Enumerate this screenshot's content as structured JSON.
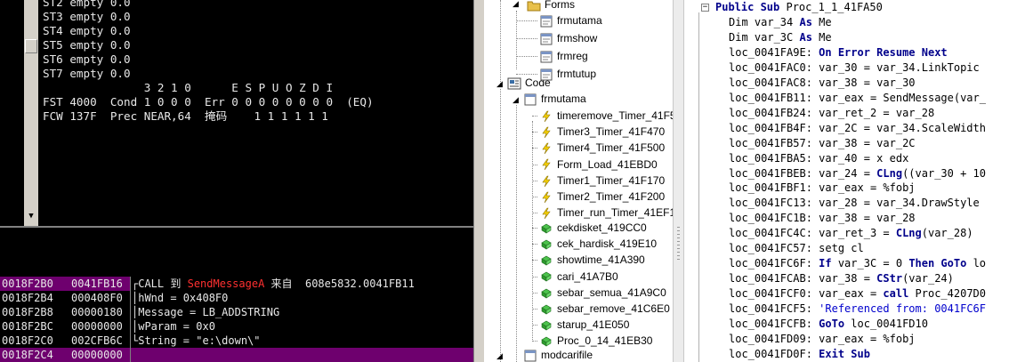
{
  "fpu": {
    "lines": [
      "ST2 empty 0.0",
      "ST3 empty 0.0",
      "ST4 empty 0.0",
      "ST5 empty 0.0",
      "ST6 empty 0.0",
      "ST7 empty 0.0",
      "               3 2 1 0      E S P U O Z D I",
      "FST 4000  Cond 1 0 0 0  Err 0 0 0 0 0 0 0 0  (EQ)",
      "FCW 137F  Prec NEAR,64  掩码    1 1 1 1 1 1"
    ]
  },
  "stack": {
    "rows": [
      {
        "addr": "0018F2B0",
        "val": "0041FB16",
        "pre": "CALL 到 ",
        "red": "SendMessageA",
        "post": " 来自  608e5832.0041FB11"
      },
      {
        "addr": "0018F2B4",
        "val": "000408F0",
        "pre": "hWnd = 0x408F0",
        "red": "",
        "post": ""
      },
      {
        "addr": "0018F2B8",
        "val": "00000180",
        "pre": "Message = LB_ADDSTRING",
        "red": "",
        "post": ""
      },
      {
        "addr": "0018F2BC",
        "val": "00000000",
        "pre": "wParam = 0x0",
        "red": "",
        "post": ""
      },
      {
        "addr": "0018F2C0",
        "val": "002CFB6C",
        "pre": "String = \"e:\\down\\\"",
        "red": "",
        "post": ""
      },
      {
        "addr": "0018F2C4",
        "val": "00000000",
        "pre": "",
        "red": "",
        "post": ""
      }
    ]
  },
  "tree": {
    "forms_label": "Forms",
    "forms": [
      "frmutama",
      "frmshow",
      "frmreg",
      "frmtutup"
    ],
    "code_label": "Code",
    "module_label": "frmutama",
    "events": [
      "timeremove_Timer_41F5",
      "Timer3_Timer_41F470",
      "Timer4_Timer_41F500",
      "Form_Load_41EBD0",
      "Timer1_Timer_41F170",
      "Timer2_Timer_41F200",
      "Timer_run_Timer_41EF1"
    ],
    "procs": [
      "cekdisket_419CC0",
      "cek_hardisk_419E10",
      "showtime_41A390",
      "cari_41A7B0",
      "sebar_semua_41A9C0",
      "sebar_remove_41C6E0",
      "starup_41E050",
      "Proc_0_14_41EB30"
    ],
    "last_label": "modcarifile"
  },
  "code": {
    "header": {
      "kw": "Public Sub",
      "rest": " Proc_1_1_41FA50"
    },
    "lines": [
      {
        "a": "Dim var_34 ",
        "k": "As",
        "b": " Me"
      },
      {
        "a": "Dim var_3C ",
        "k": "As",
        "b": " Me"
      },
      {
        "a": "loc_0041FA9E: ",
        "k": "On Error Resume Next",
        "b": ""
      },
      {
        "a": "loc_0041FAC0: var_30 = var_34.LinkTopic",
        "k": "",
        "b": ""
      },
      {
        "a": "loc_0041FAC8: var_38 = var_30",
        "k": "",
        "b": ""
      },
      {
        "a": "loc_0041FB11: var_eax = SendMessage(var_",
        "k": "",
        "b": ""
      },
      {
        "a": "loc_0041FB24: var_ret_2 = var_28",
        "k": "",
        "b": ""
      },
      {
        "a": "loc_0041FB4F: var_2C = var_34.ScaleWidth",
        "k": "",
        "b": ""
      },
      {
        "a": "loc_0041FB57: var_38 = var_2C",
        "k": "",
        "b": ""
      },
      {
        "a": "loc_0041FBA5: var_40 = x edx",
        "k": "",
        "b": ""
      },
      {
        "a": "loc_0041FBEB: var_24 = ",
        "k": "CLng",
        "b": "((var_30 + 10"
      },
      {
        "a": "loc_0041FBF1: var_eax = %fobj",
        "k": "",
        "b": ""
      },
      {
        "a": "loc_0041FC13: var_28 = var_34.DrawStyle",
        "k": "",
        "b": ""
      },
      {
        "a": "loc_0041FC1B: var_38 = var_28",
        "k": "",
        "b": ""
      },
      {
        "a": "loc_0041FC4C: var_ret_3 = ",
        "k": "CLng",
        "b": "(var_28)"
      },
      {
        "a": "loc_0041FC57: setg cl",
        "k": "",
        "b": ""
      },
      {
        "a": "loc_0041FC6F: ",
        "k": "If",
        "b": " var_3C = 0 ",
        "k2": "Then GoTo",
        "c": " lo"
      },
      {
        "a": "loc_0041FCAB: var_38 = ",
        "k": "CStr",
        "b": "(var_24)"
      },
      {
        "a": "loc_0041FCF0: var_eax = ",
        "k": "call",
        "b": " Proc_4207D0"
      },
      {
        "a": "loc_0041FCF5: ",
        "k": "",
        "b": "",
        "cm": "'Referenced from: 0041FC6F"
      },
      {
        "a": "loc_0041FCFB: ",
        "k": "GoTo",
        "b": " loc_0041FD10"
      },
      {
        "a": "loc_0041FD09: var_eax = %fobj",
        "k": "",
        "b": ""
      },
      {
        "a": "loc_0041FD0F: ",
        "k": "Exit Sub",
        "b": ""
      }
    ]
  }
}
